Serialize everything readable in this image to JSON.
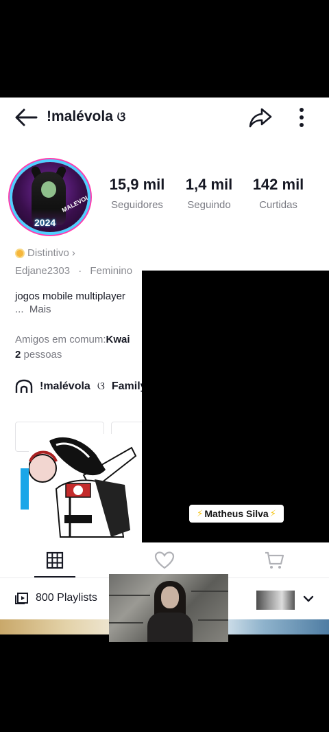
{
  "header": {
    "username": "!malévola",
    "username_glyph": "ଓ"
  },
  "avatar": {
    "year_text": "2024",
    "banner_text": "MALEVOLA"
  },
  "stats": [
    {
      "value": "15,9 mil",
      "label": "Seguidores"
    },
    {
      "value": "1,4 mil",
      "label": "Seguindo"
    },
    {
      "value": "142 mil",
      "label": "Curtidas"
    }
  ],
  "badge": {
    "label": "Distintivo",
    "chevron": "›"
  },
  "meta": {
    "handle": "Edjane2303",
    "separator": "·",
    "gender": "Feminino"
  },
  "bio": {
    "line1": "jogos mobile multiplayer",
    "more_prefix": "...",
    "more_label": "Mais"
  },
  "friends": {
    "label": "Amigos em comum:",
    "app": "Kwai",
    "count": "2",
    "suffix": "pessoas"
  },
  "family": {
    "label": "!malévola",
    "glyph": "ଓ",
    "suffix": "Family"
  },
  "overlay": {
    "name_tag": "Matheus Silva",
    "bolt": "⚡"
  },
  "playlists": {
    "label": "800 Playlists"
  },
  "tabs": [
    {
      "name": "grid",
      "icon": "grid-icon"
    },
    {
      "name": "liked",
      "icon": "heart-icon"
    },
    {
      "name": "shop",
      "icon": "cart-icon"
    }
  ],
  "colors": {
    "text": "#161823",
    "muted": "#7a7b83",
    "badge": "#f6b63b",
    "accent_blue": "#1aa6e8"
  }
}
